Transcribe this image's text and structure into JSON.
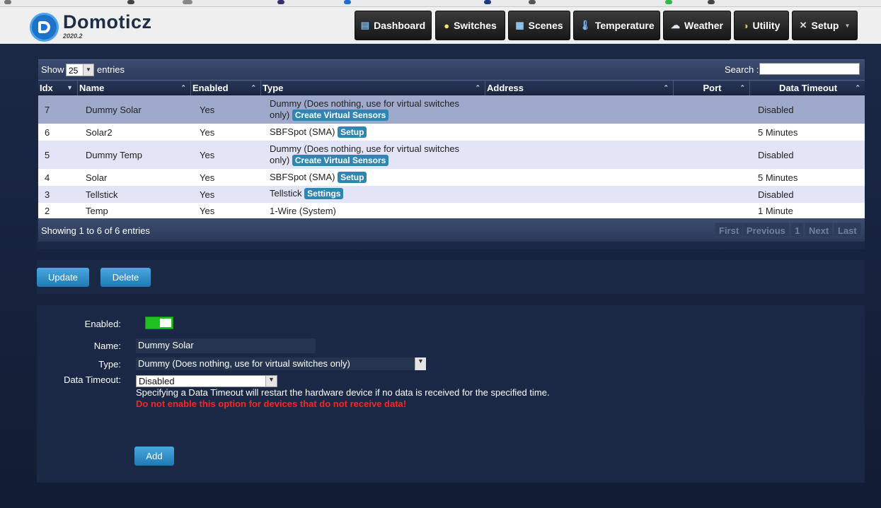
{
  "header": {
    "logo_text": "Domoticz",
    "version": "2020.2",
    "nav": [
      {
        "label": "Dashboard",
        "icon": "dashboard-icon"
      },
      {
        "label": "Switches",
        "icon": "lightbulb-icon"
      },
      {
        "label": "Scenes",
        "icon": "scenes-icon"
      },
      {
        "label": "Temperature",
        "icon": "thermometer-icon"
      },
      {
        "label": "Weather",
        "icon": "weather-icon"
      },
      {
        "label": "Utility",
        "icon": "utility-icon"
      },
      {
        "label": "Setup",
        "icon": "tools-icon"
      }
    ]
  },
  "table": {
    "show_label": "Show",
    "page_size": "25",
    "entries_label": "entries",
    "search_label": "Search :",
    "search_value": "",
    "columns": [
      "Idx",
      "Name",
      "Enabled",
      "Type",
      "Address",
      "Port",
      "Data Timeout"
    ],
    "rows": [
      {
        "idx": "7",
        "name": "Dummy Solar",
        "enabled": "Yes",
        "type": "Dummy (Does nothing, use for virtual switches only)",
        "action": "Create Virtual Sensors",
        "address": "",
        "port": "",
        "timeout": "Disabled"
      },
      {
        "idx": "6",
        "name": "Solar2",
        "enabled": "Yes",
        "type": "SBFSpot (SMA)",
        "action": "Setup",
        "address": "",
        "port": "",
        "timeout": "5 Minutes"
      },
      {
        "idx": "5",
        "name": "Dummy Temp",
        "enabled": "Yes",
        "type": "Dummy (Does nothing, use for virtual switches only)",
        "action": "Create Virtual Sensors",
        "address": "",
        "port": "",
        "timeout": "Disabled"
      },
      {
        "idx": "4",
        "name": "Solar",
        "enabled": "Yes",
        "type": "SBFSpot (SMA)",
        "action": "Setup",
        "address": "",
        "port": "",
        "timeout": "5 Minutes"
      },
      {
        "idx": "3",
        "name": "Tellstick",
        "enabled": "Yes",
        "type": "Tellstick",
        "action": "Settings",
        "address": "",
        "port": "",
        "timeout": "Disabled"
      },
      {
        "idx": "2",
        "name": "Temp",
        "enabled": "Yes",
        "type": "1-Wire (System)",
        "action": "",
        "address": "",
        "port": "",
        "timeout": "1 Minute"
      }
    ],
    "info": "Showing 1 to 6 of 6 entries",
    "pager": [
      "First",
      "Previous",
      "1",
      "Next",
      "Last"
    ]
  },
  "actions": {
    "update_label": "Update",
    "delete_label": "Delete"
  },
  "form": {
    "enabled_label": "Enabled:",
    "enabled": true,
    "name_label": "Name:",
    "name_value": "Dummy Solar",
    "type_label": "Type:",
    "type_value": "Dummy (Does nothing, use for virtual switches only)",
    "timeout_label": "Data Timeout:",
    "timeout_value": "Disabled",
    "help": "Specifying a Data Timeout will restart the hardware device if no data is received for the specified time.",
    "warning": "Do not enable this option for devices that do not receive data!",
    "add_label": "Add"
  },
  "colors": {
    "selected_row": "#9fa9cb",
    "alt_row": "#e3e5f6",
    "badge": "#2f86b3",
    "toggle_on": "#20c020",
    "warning": "#ff2222"
  }
}
